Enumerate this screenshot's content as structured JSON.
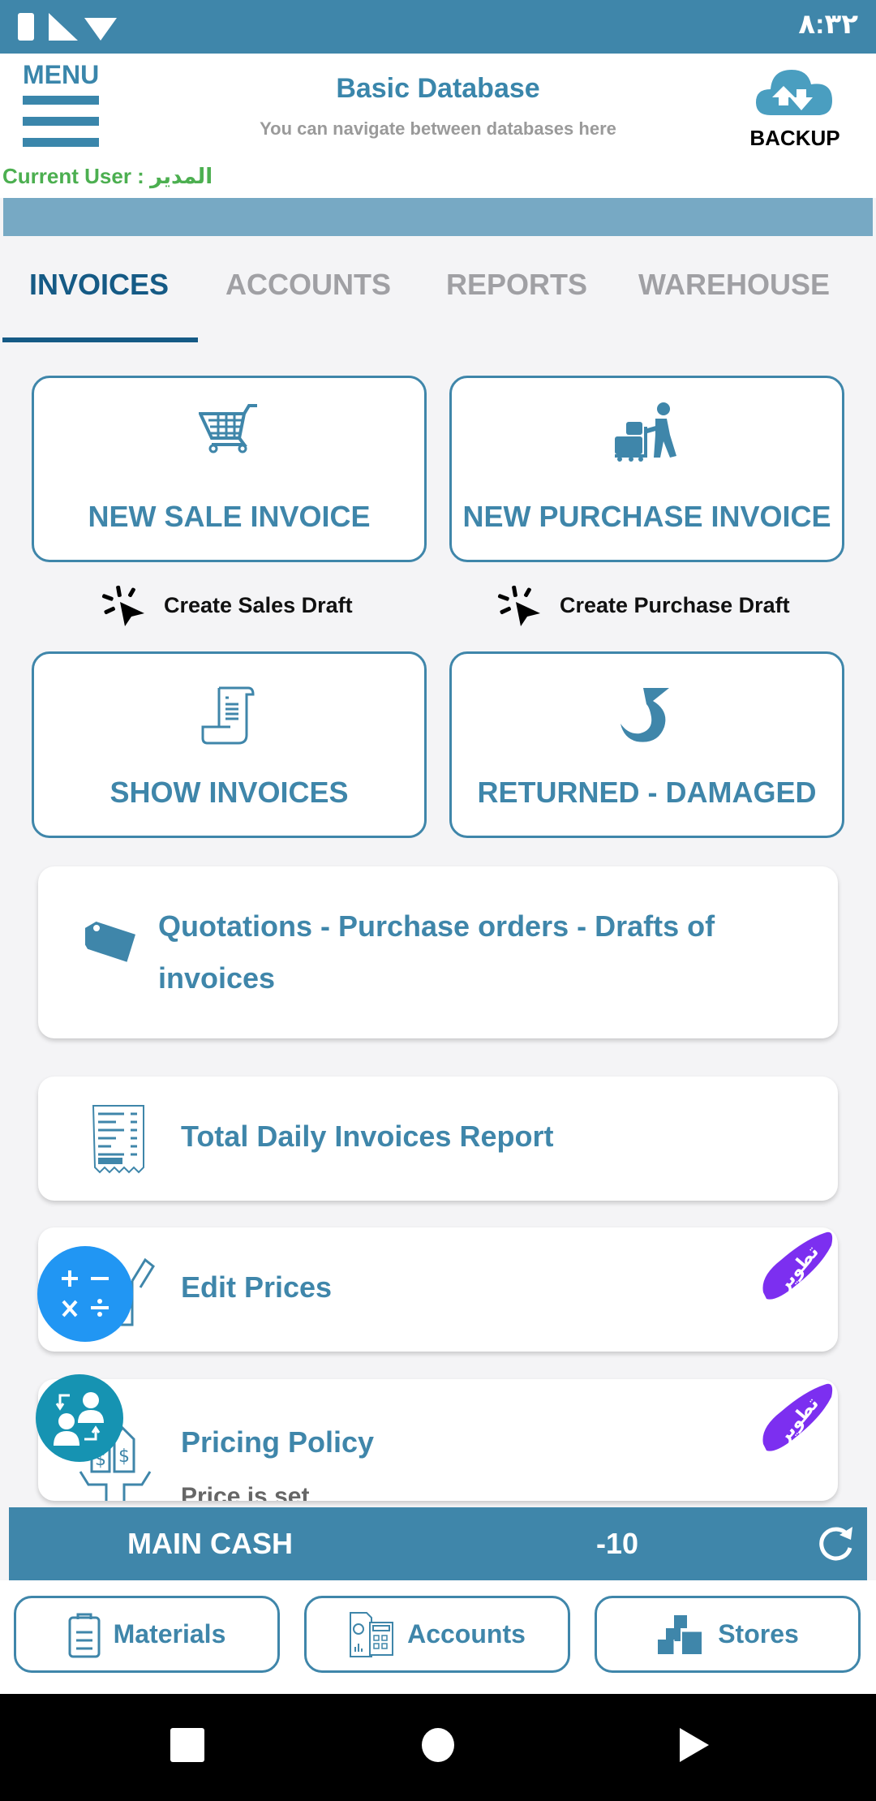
{
  "status_bar": {
    "time": "٨:٣٢",
    "icons": [
      "battery-icon",
      "signal-icon",
      "wifi-icon"
    ]
  },
  "header": {
    "menu_label": "MENU",
    "title": "Basic Database",
    "subtitle": "You can navigate between databases here",
    "backup_label": "BACKUP",
    "current_user": "Current User : المدير"
  },
  "tabs": [
    {
      "label": "INVOICES",
      "active": true
    },
    {
      "label": "ACCOUNTS",
      "active": false
    },
    {
      "label": "REPORTS",
      "active": false
    },
    {
      "label": "WAREHOUSE",
      "active": false
    }
  ],
  "cards": {
    "new_sale": "NEW SALE INVOICE",
    "new_purchase": "NEW PURCHASE INVOICE",
    "sales_draft": "Create Sales Draft",
    "purchase_draft": "Create Purchase Draft",
    "show_invoices": "SHOW INVOICES",
    "returned": "RETURNED - DAMAGED"
  },
  "list": [
    {
      "label": "Quotations - Purchase orders - Drafts of invoices",
      "icon": "tag-icon"
    },
    {
      "label": "Total Daily Invoices Report",
      "icon": "receipt-icon"
    },
    {
      "label": "Edit Prices",
      "icon": "edit-price-icon",
      "badge": "تطوير"
    },
    {
      "label": "Pricing Policy",
      "sublabel": "Price is set",
      "icon": "price-tags-icon",
      "badge": "تطوير"
    }
  ],
  "cash": {
    "name": "MAIN CASH",
    "value": "-10"
  },
  "bottom_buttons": [
    {
      "label": "Materials"
    },
    {
      "label": "Accounts"
    },
    {
      "label": "Stores"
    }
  ],
  "colors": {
    "primary": "#3f86aa",
    "tab_active": "#155a85",
    "user_green": "#4caf50",
    "badge_purple": "#7c2ff0",
    "fab_blue": "#2196f3",
    "fab_teal": "#1693b2"
  }
}
